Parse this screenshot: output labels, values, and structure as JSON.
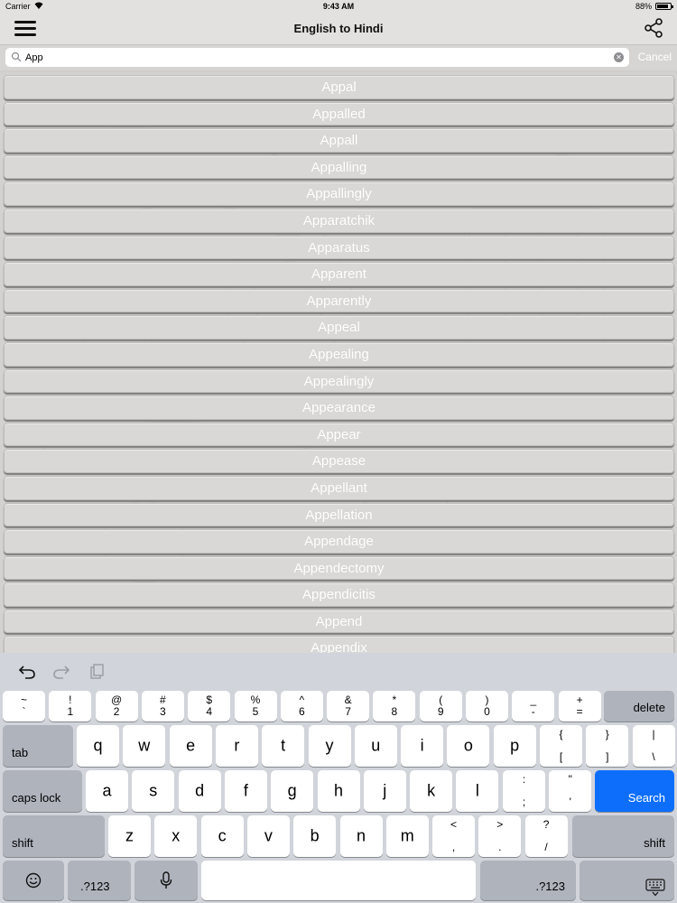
{
  "status": {
    "carrier": "Carrier",
    "time": "9:43 AM",
    "battery": "88%",
    "battery_level": 0.88
  },
  "nav": {
    "title": "English to Hindi",
    "menu_icon": "hamburger-menu-icon",
    "share_icon": "share-icon"
  },
  "search": {
    "value": "App",
    "cancel": "Cancel"
  },
  "results": [
    "Appal",
    "Appalled",
    "Appall",
    "Appalling",
    "Appallingly",
    "Apparatchik",
    "Apparatus",
    "Apparent",
    "Apparently",
    "Appeal",
    "Appealing",
    "Appealingly",
    "Appearance",
    "Appear",
    "Appease",
    "Appellant",
    "Appellation",
    "Appendage",
    "Appendectomy",
    "Appendicitis",
    "Append",
    "Appendix"
  ],
  "keyboard": {
    "toolbar": [
      "undo-icon",
      "redo-icon",
      "paste-icon"
    ],
    "number_row": [
      {
        "top": "~",
        "bot": "`"
      },
      {
        "top": "!",
        "bot": "1"
      },
      {
        "top": "@",
        "bot": "2"
      },
      {
        "top": "#",
        "bot": "3"
      },
      {
        "top": "$",
        "bot": "4"
      },
      {
        "top": "%",
        "bot": "5"
      },
      {
        "top": "^",
        "bot": "6"
      },
      {
        "top": "&",
        "bot": "7"
      },
      {
        "top": "*",
        "bot": "8"
      },
      {
        "top": "(",
        "bot": "9"
      },
      {
        "top": ")",
        "bot": "0"
      },
      {
        "top": "_",
        "bot": "-"
      },
      {
        "top": "+",
        "bot": "="
      }
    ],
    "delete": "delete",
    "tab": "tab",
    "row_q": [
      "q",
      "w",
      "e",
      "r",
      "t",
      "y",
      "u",
      "i",
      "o",
      "p"
    ],
    "row_q_extra": [
      {
        "top": "{",
        "bot": "["
      },
      {
        "top": "}",
        "bot": "]"
      },
      {
        "top": "|",
        "bot": "\\"
      }
    ],
    "caps": "caps lock",
    "row_a": [
      "a",
      "s",
      "d",
      "f",
      "g",
      "h",
      "j",
      "k",
      "l"
    ],
    "row_a_extra": [
      {
        "top": ":",
        "bot": ";"
      },
      {
        "top": "\"",
        "bot": "'"
      }
    ],
    "search": "Search",
    "shift": "shift",
    "row_z": [
      "z",
      "x",
      "c",
      "v",
      "b",
      "n",
      "m"
    ],
    "row_z_extra": [
      {
        "top": "<",
        "bot": ","
      },
      {
        "top": ">",
        "bot": "."
      },
      {
        "top": "?",
        "bot": "/"
      }
    ],
    "emoji_icon": "emoji-icon",
    "num_toggle": ".?123",
    "mic_icon": "microphone-icon",
    "hide_icon": "keyboard-hide-icon"
  }
}
